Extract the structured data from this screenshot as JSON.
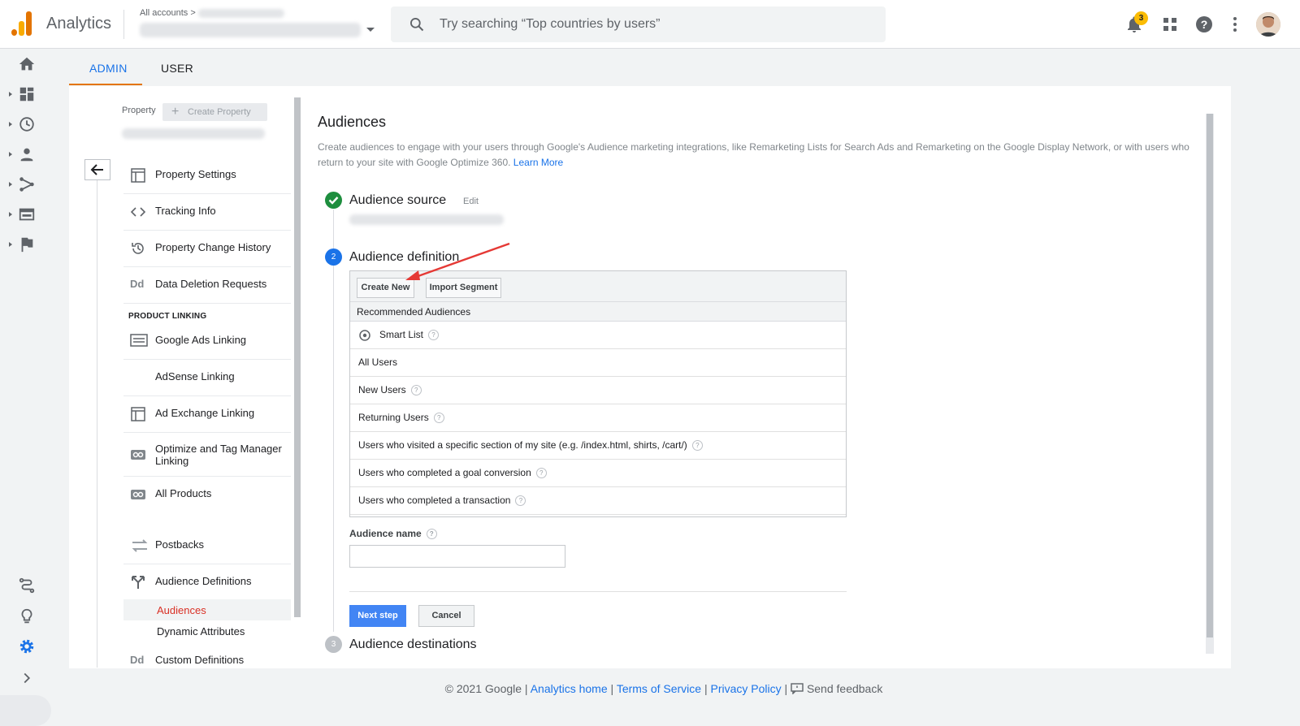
{
  "header": {
    "app_title": "Analytics",
    "accounts_crumb": "All accounts",
    "search_placeholder": "Try searching “Top countries by users”",
    "notification_count": "3"
  },
  "tabs": [
    {
      "label": "ADMIN",
      "active": true
    },
    {
      "label": "USER",
      "active": false
    }
  ],
  "property": {
    "label": "Property",
    "create_label": "Create Property"
  },
  "menu": {
    "items": [
      {
        "label": "Property Settings",
        "icon": "layout-icon"
      },
      {
        "label": "Tracking Info",
        "icon": "code-icon"
      },
      {
        "label": "Property Change History",
        "icon": "history-icon"
      },
      {
        "label": "Data Deletion Requests",
        "icon": "dd-icon"
      }
    ],
    "section_label": "PRODUCT LINKING",
    "linking_items": [
      {
        "label": "Google Ads Linking",
        "icon": "ads-icon"
      },
      {
        "label": "AdSense Linking",
        "icon": ""
      },
      {
        "label": "Ad Exchange Linking",
        "icon": "layout-icon"
      },
      {
        "label": "Optimize and Tag Manager Linking",
        "icon": "link-icon"
      },
      {
        "label": "All Products",
        "icon": "link-icon"
      },
      {
        "label": "Postbacks",
        "icon": "postback-icon"
      },
      {
        "label": "Audience Definitions",
        "icon": "fork-icon"
      }
    ],
    "sub_items": [
      "Audiences",
      "Dynamic Attributes"
    ],
    "custom_definitions": "Custom Definitions"
  },
  "main": {
    "title": "Audiences",
    "description": "Create audiences to engage with your users through Google's Audience marketing integrations, like Remarketing Lists for Search Ads and Remarketing on the Google Display Network, or with users who return to your site with Google Optimize 360.",
    "learn_more": "Learn More",
    "steps": [
      {
        "number": "",
        "title": "Audience source",
        "status": "done",
        "edit": "Edit"
      },
      {
        "number": "2",
        "title": "Audience definition",
        "status": "active"
      },
      {
        "number": "3",
        "title": "Audience destinations",
        "status": "pending"
      }
    ],
    "create_new": "Create New",
    "import_segment": "Import Segment",
    "recommended_header": "Recommended Audiences",
    "audiences": [
      "Smart List",
      "All Users",
      "New Users",
      "Returning Users",
      "Users who visited a specific section of my site (e.g. /index.html, shirts, /cart/)",
      "Users who completed a goal conversion",
      "Users who completed a transaction"
    ],
    "audience_name_label": "Audience name",
    "audience_name_value": "",
    "next_step": "Next step",
    "cancel": "Cancel"
  },
  "footer": {
    "copyright": "© 2021 Google",
    "links": [
      "Analytics home",
      "Terms of Service",
      "Privacy Policy"
    ],
    "feedback": "Send feedback"
  },
  "colors": {
    "accent": "#1a73e8",
    "tab_underline": "#e37400",
    "active_red": "#d93025",
    "done_green": "#1e8e3e",
    "primary_button": "#4285f4"
  }
}
